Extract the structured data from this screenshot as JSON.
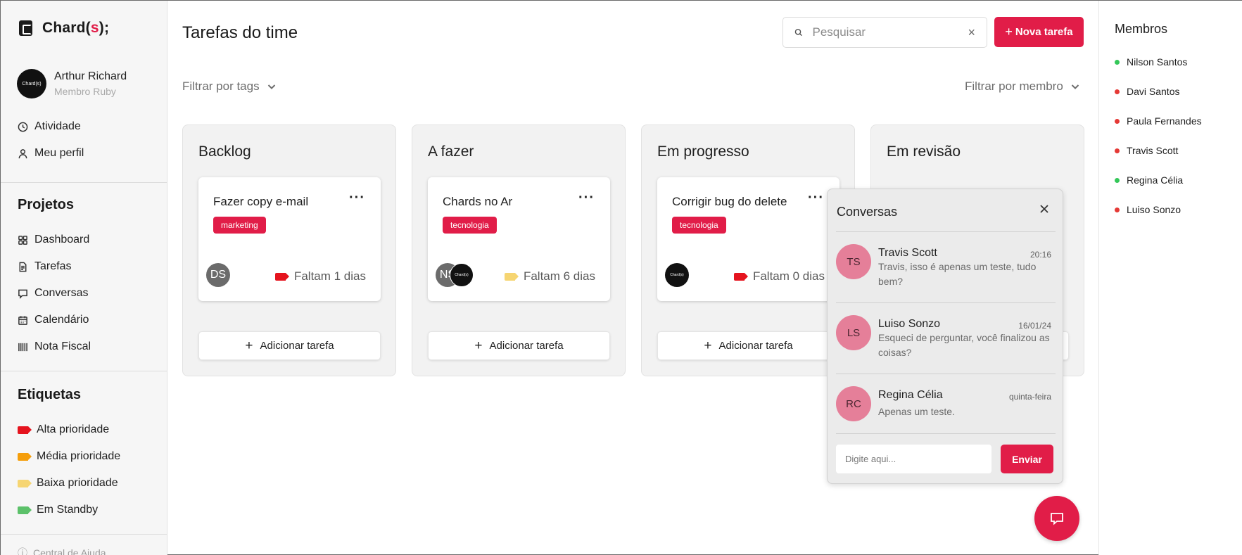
{
  "brand": {
    "name_prefix": "Chard(",
    "name_accent": "s",
    "name_suffix": ");"
  },
  "user": {
    "name": "Arthur Richard",
    "role": "Membro Ruby",
    "avatar_text": "Chard(s)"
  },
  "nav_top": [
    {
      "label": "Atividade",
      "icon": "clock-icon"
    },
    {
      "label": "Meu perfil",
      "icon": "user-icon"
    }
  ],
  "projects": {
    "title": "Projetos",
    "items": [
      {
        "label": "Dashboard",
        "icon": "grid-icon"
      },
      {
        "label": "Tarefas",
        "icon": "document-icon"
      },
      {
        "label": "Conversas",
        "icon": "chat-icon"
      },
      {
        "label": "Calendário",
        "icon": "calendar-icon"
      },
      {
        "label": "Nota Fiscal",
        "icon": "barcode-icon"
      }
    ]
  },
  "labels": {
    "title": "Etiquetas",
    "items": [
      {
        "label": "Alta prioridade",
        "color": "#e5141e"
      },
      {
        "label": "Média prioridade",
        "color": "#f59e0b"
      },
      {
        "label": "Baixa prioridade",
        "color": "#f6d572"
      },
      {
        "label": "Em Standby",
        "color": "#5cc16a"
      }
    ]
  },
  "help": {
    "label": "Central de Ajuda"
  },
  "header": {
    "title": "Tarefas do time",
    "search_placeholder": "Pesquisar",
    "clear_icon": "×",
    "new_task_plus": "+",
    "new_task_label": "Nova tarefa"
  },
  "filters": {
    "tags": "Filtrar por tags",
    "member": "Filtrar por membro"
  },
  "columns": [
    {
      "title": "Backlog",
      "card": {
        "title": "Fazer copy e-mail",
        "more": "···",
        "tag": "marketing",
        "assignees": [
          {
            "text": "DS",
            "bg": "#6b6b6b"
          }
        ],
        "deadline": "Faltam 1 dias",
        "deadline_color": "#e5141e"
      },
      "add_label": "Adicionar tarefa"
    },
    {
      "title": "A fazer",
      "card": {
        "title": "Chards no Ar",
        "more": "···",
        "tag": "tecnologia",
        "assignees": [
          {
            "text": "NS",
            "bg": "#6b6b6b"
          },
          {
            "text": "Chard(s)",
            "bg": "#111111"
          }
        ],
        "deadline": "Faltam 6 dias",
        "deadline_color": "#f6d572"
      },
      "add_label": "Adicionar tarefa"
    },
    {
      "title": "Em progresso",
      "card": {
        "title": "Corrigir bug do delete",
        "more": "···",
        "tag": "tecnologia",
        "assignees": [
          {
            "text": "Chard(s)",
            "bg": "#111111"
          }
        ],
        "deadline": "Faltam 0 dias",
        "deadline_color": "#e5141e"
      },
      "add_label": "Adicionar tarefa"
    },
    {
      "title": "Em revisão"
    }
  ],
  "chat": {
    "title": "Conversas",
    "conversations": [
      {
        "initials": "TS",
        "name": "Travis Scott",
        "time": "20:16",
        "message": "Travis, isso é apenas um teste, tudo bem?"
      },
      {
        "initials": "LS",
        "name": "Luiso Sonzo",
        "time": "16/01/24",
        "message": "Esqueci de perguntar, você finalizou as coisas?"
      },
      {
        "initials": "RC",
        "name": "Regina Célia",
        "time": "quinta-feira",
        "message": "Apenas um teste."
      }
    ],
    "input_placeholder": "Digite aqui...",
    "send_label": "Enviar"
  },
  "members": {
    "title": "Membros",
    "items": [
      {
        "name": "Nilson Santos",
        "status_color": "#34c759"
      },
      {
        "name": "Davi Santos",
        "status_color": "#e53935"
      },
      {
        "name": "Paula Fernandes",
        "status_color": "#e53935"
      },
      {
        "name": "Travis Scott",
        "status_color": "#e53935"
      },
      {
        "name": "Regina Célia",
        "status_color": "#34c759"
      },
      {
        "name": "Luiso Sonzo",
        "status_color": "#e53935"
      }
    ]
  }
}
